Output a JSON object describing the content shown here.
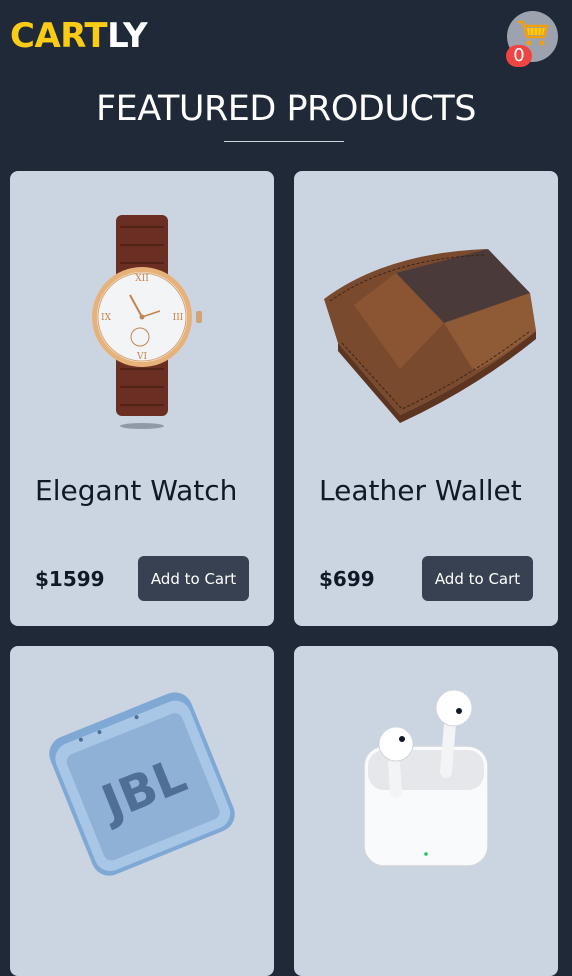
{
  "header": {
    "logo_part1": "CART",
    "logo_part2": "LY",
    "cart_icon": "shopping-cart-icon",
    "cart_count": "0"
  },
  "main": {
    "title": "FEATURED PRODUCTS"
  },
  "products": [
    {
      "name": "Elegant Watch",
      "price": "$1599",
      "button": "Add to Cart",
      "image": "watch-image"
    },
    {
      "name": "Leather Wallet",
      "price": "$699",
      "button": "Add to Cart",
      "image": "wallet-image"
    },
    {
      "name": "",
      "price": "",
      "button": "",
      "image": "speaker-image"
    },
    {
      "name": "",
      "price": "",
      "button": "",
      "image": "earbuds-image"
    }
  ],
  "colors": {
    "background": "#1f2937",
    "card": "#cbd5e1",
    "logo_accent": "#facc15",
    "button": "#374151",
    "badge": "#ef4444"
  }
}
